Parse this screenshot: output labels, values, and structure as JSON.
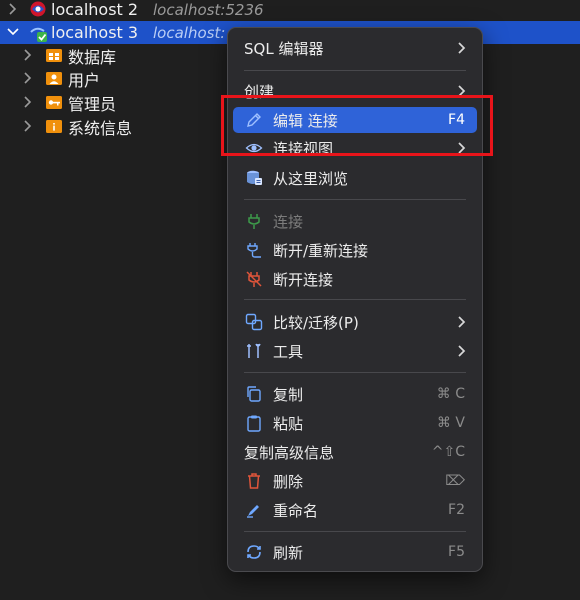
{
  "tree": {
    "conn2": {
      "name": "localhost 2",
      "host": "localhost:5236"
    },
    "conn3": {
      "name": "localhost 3",
      "host": "localhost:"
    },
    "children": [
      "数据库",
      "用户",
      "管理员",
      "系统信息"
    ]
  },
  "menu": {
    "sql_editor": "SQL 编辑器",
    "create": "创建",
    "edit_connection": "编辑 连接",
    "edit_connection_shortcut": "F4",
    "connection_view": "连接视图",
    "browse_here": "从这里浏览",
    "connect": "连接",
    "disconnect_reconnect": "断开/重新连接",
    "disconnect": "断开连接",
    "compare_migrate": "比较/迁移(P)",
    "tools": "工具",
    "copy": "复制",
    "copy_shortcut": "⌘ C",
    "paste": "粘贴",
    "paste_shortcut": "⌘ V",
    "copy_advanced": "复制高级信息",
    "copy_advanced_shortcut": "^⇧C",
    "delete": "删除",
    "delete_shortcut": "⌦",
    "rename": "重命名",
    "rename_shortcut": "F2",
    "refresh": "刷新",
    "refresh_shortcut": "F5"
  },
  "colors": {
    "selection": "#1e52c9",
    "menu_active": "#2f63d8",
    "highlight_box": "#e8141a",
    "folder_orange": "#f0900c"
  }
}
